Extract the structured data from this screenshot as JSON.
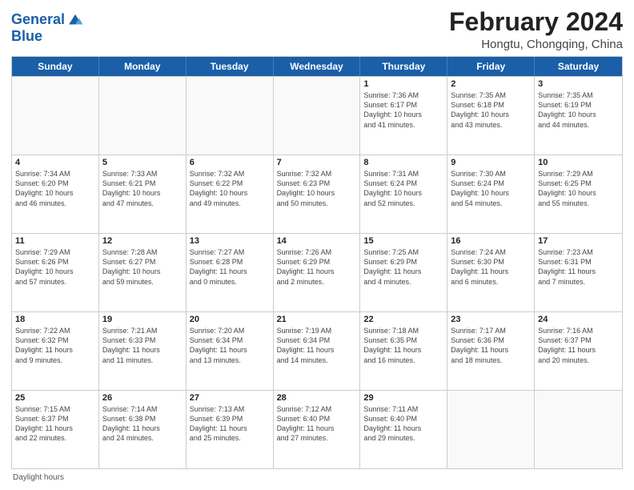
{
  "header": {
    "logo_line1": "General",
    "logo_line2": "Blue",
    "title": "February 2024",
    "subtitle": "Hongtu, Chongqing, China"
  },
  "weekdays": [
    "Sunday",
    "Monday",
    "Tuesday",
    "Wednesday",
    "Thursday",
    "Friday",
    "Saturday"
  ],
  "footer": {
    "label": "Daylight hours"
  },
  "weeks": [
    [
      {
        "day": "",
        "info": ""
      },
      {
        "day": "",
        "info": ""
      },
      {
        "day": "",
        "info": ""
      },
      {
        "day": "",
        "info": ""
      },
      {
        "day": "1",
        "info": "Sunrise: 7:36 AM\nSunset: 6:17 PM\nDaylight: 10 hours\nand 41 minutes."
      },
      {
        "day": "2",
        "info": "Sunrise: 7:35 AM\nSunset: 6:18 PM\nDaylight: 10 hours\nand 43 minutes."
      },
      {
        "day": "3",
        "info": "Sunrise: 7:35 AM\nSunset: 6:19 PM\nDaylight: 10 hours\nand 44 minutes."
      }
    ],
    [
      {
        "day": "4",
        "info": "Sunrise: 7:34 AM\nSunset: 6:20 PM\nDaylight: 10 hours\nand 46 minutes."
      },
      {
        "day": "5",
        "info": "Sunrise: 7:33 AM\nSunset: 6:21 PM\nDaylight: 10 hours\nand 47 minutes."
      },
      {
        "day": "6",
        "info": "Sunrise: 7:32 AM\nSunset: 6:22 PM\nDaylight: 10 hours\nand 49 minutes."
      },
      {
        "day": "7",
        "info": "Sunrise: 7:32 AM\nSunset: 6:23 PM\nDaylight: 10 hours\nand 50 minutes."
      },
      {
        "day": "8",
        "info": "Sunrise: 7:31 AM\nSunset: 6:24 PM\nDaylight: 10 hours\nand 52 minutes."
      },
      {
        "day": "9",
        "info": "Sunrise: 7:30 AM\nSunset: 6:24 PM\nDaylight: 10 hours\nand 54 minutes."
      },
      {
        "day": "10",
        "info": "Sunrise: 7:29 AM\nSunset: 6:25 PM\nDaylight: 10 hours\nand 55 minutes."
      }
    ],
    [
      {
        "day": "11",
        "info": "Sunrise: 7:29 AM\nSunset: 6:26 PM\nDaylight: 10 hours\nand 57 minutes."
      },
      {
        "day": "12",
        "info": "Sunrise: 7:28 AM\nSunset: 6:27 PM\nDaylight: 10 hours\nand 59 minutes."
      },
      {
        "day": "13",
        "info": "Sunrise: 7:27 AM\nSunset: 6:28 PM\nDaylight: 11 hours\nand 0 minutes."
      },
      {
        "day": "14",
        "info": "Sunrise: 7:26 AM\nSunset: 6:29 PM\nDaylight: 11 hours\nand 2 minutes."
      },
      {
        "day": "15",
        "info": "Sunrise: 7:25 AM\nSunset: 6:29 PM\nDaylight: 11 hours\nand 4 minutes."
      },
      {
        "day": "16",
        "info": "Sunrise: 7:24 AM\nSunset: 6:30 PM\nDaylight: 11 hours\nand 6 minutes."
      },
      {
        "day": "17",
        "info": "Sunrise: 7:23 AM\nSunset: 6:31 PM\nDaylight: 11 hours\nand 7 minutes."
      }
    ],
    [
      {
        "day": "18",
        "info": "Sunrise: 7:22 AM\nSunset: 6:32 PM\nDaylight: 11 hours\nand 9 minutes."
      },
      {
        "day": "19",
        "info": "Sunrise: 7:21 AM\nSunset: 6:33 PM\nDaylight: 11 hours\nand 11 minutes."
      },
      {
        "day": "20",
        "info": "Sunrise: 7:20 AM\nSunset: 6:34 PM\nDaylight: 11 hours\nand 13 minutes."
      },
      {
        "day": "21",
        "info": "Sunrise: 7:19 AM\nSunset: 6:34 PM\nDaylight: 11 hours\nand 14 minutes."
      },
      {
        "day": "22",
        "info": "Sunrise: 7:18 AM\nSunset: 6:35 PM\nDaylight: 11 hours\nand 16 minutes."
      },
      {
        "day": "23",
        "info": "Sunrise: 7:17 AM\nSunset: 6:36 PM\nDaylight: 11 hours\nand 18 minutes."
      },
      {
        "day": "24",
        "info": "Sunrise: 7:16 AM\nSunset: 6:37 PM\nDaylight: 11 hours\nand 20 minutes."
      }
    ],
    [
      {
        "day": "25",
        "info": "Sunrise: 7:15 AM\nSunset: 6:37 PM\nDaylight: 11 hours\nand 22 minutes."
      },
      {
        "day": "26",
        "info": "Sunrise: 7:14 AM\nSunset: 6:38 PM\nDaylight: 11 hours\nand 24 minutes."
      },
      {
        "day": "27",
        "info": "Sunrise: 7:13 AM\nSunset: 6:39 PM\nDaylight: 11 hours\nand 25 minutes."
      },
      {
        "day": "28",
        "info": "Sunrise: 7:12 AM\nSunset: 6:40 PM\nDaylight: 11 hours\nand 27 minutes."
      },
      {
        "day": "29",
        "info": "Sunrise: 7:11 AM\nSunset: 6:40 PM\nDaylight: 11 hours\nand 29 minutes."
      },
      {
        "day": "",
        "info": ""
      },
      {
        "day": "",
        "info": ""
      }
    ]
  ]
}
